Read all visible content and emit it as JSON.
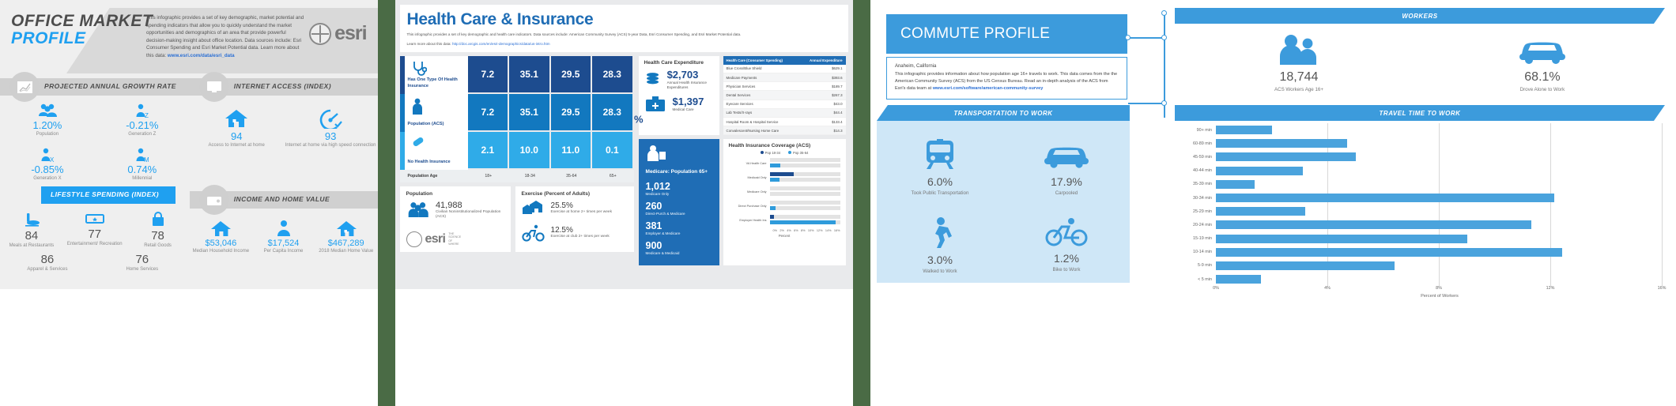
{
  "panel1": {
    "title_line1": "OFFICE MARKET",
    "title_line2": "PROFILE",
    "description": "This infographic provides a set of key demographic, market potential and spending indicators that allow you to quickly understand the market opportunities and demographics of an area that provide powerful decision-making insight about office location.\nData sources include: Esri Consumer Spending and Esri Market Potential data.\nLearn more about this data:",
    "description_link": "www.esri.com/data/esri_data",
    "brand": "esri",
    "sections": {
      "growth": {
        "band_label": "PROJECTED ANNUAL GROWTH RATE",
        "icon": "line-chart-icon",
        "stats": [
          {
            "value": "1.20%",
            "caption": "Population",
            "icon": "people-group-icon"
          },
          {
            "value": "-0.21%",
            "caption": "Generation Z",
            "icon": "person-z-icon"
          },
          {
            "value": "-0.85%",
            "caption": "Generation X",
            "icon": "person-x-icon"
          },
          {
            "value": "0.74%",
            "caption": "Millennial",
            "icon": "person-m-icon"
          }
        ]
      },
      "internet": {
        "band_label": "INTERNET ACCESS (INDEX)",
        "icon": "monitor-icon",
        "stats": [
          {
            "value": "94",
            "caption": "Access to Internet at home",
            "icon": "house-icon"
          },
          {
            "value": "93",
            "caption": "Internet at home via high speed connection",
            "icon": "speed-gauge-icon"
          }
        ]
      },
      "lifestyle": {
        "band_label": "LIFESTYLE SPENDING (INDEX)",
        "stats": [
          {
            "value": "84",
            "caption": "Meals at Restaurants",
            "icon": "food-drink-icon"
          },
          {
            "value": "77",
            "caption": "Entertainment/ Recreation",
            "icon": "ticket-icon"
          },
          {
            "value": "78",
            "caption": "Retail Goods",
            "icon": "shopping-bag-icon"
          },
          {
            "value": "86",
            "caption": "Apparel & Services",
            "icon": "apparel-icon"
          },
          {
            "value": "76",
            "caption": "Home Services",
            "icon": "home-services-icon"
          }
        ]
      },
      "income": {
        "band_label": "INCOME AND HOME VALUE",
        "icon": "wallet-icon",
        "stats": [
          {
            "value": "$53,046",
            "caption": "Median Household Income",
            "icon": "house-income-icon"
          },
          {
            "value": "$17,524",
            "caption": "Per Capita Income",
            "icon": "person-income-icon"
          },
          {
            "value": "$467,289",
            "caption": "2018 Median Home Value",
            "icon": "home-value-icon"
          }
        ]
      }
    }
  },
  "panel2": {
    "title": "Health Care & Insurance",
    "subtitle": "This infographic provides a set of key demographic and health care indicators. Data sources include: American Community Survey (ACS) 5-year Data, Esri Consumer Spending, and Esri Market Potential data.",
    "link_label": "Learn more about this data:",
    "link_url": "http://doc.arcgis.com/en/esri-demographics/data/us-intro.htm",
    "insurance_table": {
      "rows": [
        {
          "label": "Has One Type Of Health Insurance",
          "icon": "stethoscope-icon",
          "color": "#1d4c8f",
          "values": [
            "7.2",
            "35.1",
            "29.5",
            "28.3"
          ]
        },
        {
          "label": "Population (ACS)",
          "icon": "person-icon",
          "color": "#1278bf",
          "values": [
            "7.2",
            "35.1",
            "29.5",
            "28.3"
          ]
        },
        {
          "label": "No Health Insurance",
          "icon": "pill-icon",
          "color": "#2fabe8",
          "values": [
            "2.1",
            "10.0",
            "11.0",
            "0.1"
          ]
        }
      ],
      "footer_label": "Population Age",
      "age_groups": [
        "18+",
        "18-34",
        "35-64",
        "65+"
      ],
      "unit": "%"
    },
    "population_card": {
      "header": "Population",
      "value": "41,988",
      "caption": "Civilian Noninstitutionalized Population (ACS)",
      "icon": "people-group-icon"
    },
    "exercise_card": {
      "header": "Exercise (Percent of Adults)",
      "items": [
        {
          "value": "25.5%",
          "caption": "Exercise at home 2+ times per week",
          "icon": "home-exercise-icon"
        },
        {
          "value": "12.5%",
          "caption": "Exercise at club 2+ times per week",
          "icon": "bicycle-icon"
        }
      ]
    },
    "expenditure_card": {
      "header": "Health Care Expenditure",
      "items": [
        {
          "value": "$2,703",
          "caption": "Annual Health Insurance Expenditures",
          "icon": "coins-icon"
        },
        {
          "value": "$1,397",
          "caption": "Medical Care",
          "icon": "medical-bag-icon"
        }
      ]
    },
    "spending_table": {
      "col_category": "Health Care (Consumer Spending)",
      "col_value": "Annual Expenditure",
      "rows": [
        {
          "label": "Blue Cross/Blue Shield",
          "value": "$629.1"
        },
        {
          "label": "Medicare Payments",
          "value": "$393.6"
        },
        {
          "label": "Physician Services",
          "value": "$189.7"
        },
        {
          "label": "Dental Services",
          "value": "$267.3"
        },
        {
          "label": "Eyecare Services",
          "value": "$43.0"
        },
        {
          "label": "Lab Tests/X-rays",
          "value": "$44.4"
        },
        {
          "label": "Hospital Room & Hospital Service",
          "value": "$133.4"
        },
        {
          "label": "Convalescent/Nursing Home Care",
          "value": "$14.3"
        }
      ]
    },
    "medicare_box": {
      "header": "Medicare: Population 65+",
      "icon": "person-medicare-icon",
      "items": [
        {
          "value": "1,012",
          "caption": "Medicare Only"
        },
        {
          "value": "260",
          "caption": "Direct-Purch & Medicare"
        },
        {
          "value": "381",
          "caption": "Employer & Medicare"
        },
        {
          "value": "900",
          "caption": "Medicare & Medicaid"
        }
      ]
    },
    "coverage_chart": {
      "title": "Health Insurance Coverage (ACS)",
      "legend": [
        {
          "label": "Pop 18-34",
          "color": "#1d4c8f"
        },
        {
          "label": "Pop 35-64",
          "color": "#2f9bdb"
        }
      ],
      "xlabel": "Percent",
      "x_ticks": [
        "0%",
        "2%",
        "4%",
        "6%",
        "8%",
        "10%",
        "12%",
        "14%",
        "16%"
      ],
      "rows": [
        {
          "label": "VA Health Care",
          "pop1834": 0.0,
          "pop3564": 2.5
        },
        {
          "label": "Medicaid Only",
          "pop1834": 5.4,
          "pop3564": 2.3
        },
        {
          "label": "Medicare Only",
          "pop1834": 0.0,
          "pop3564": 0.0
        },
        {
          "label": "Direct Purchase Only",
          "pop1834": 0.0,
          "pop3564": 1.3
        },
        {
          "label": "Employer Health Ins",
          "pop1834": 0.9,
          "pop3564": 15.1
        }
      ],
      "xmax": 16
    }
  },
  "panel3": {
    "title": "COMMUTE PROFILE",
    "place": "Anaheim, California",
    "description": "This infographic provides information about how population age 16+ travels to work. This data comes from the the American Community Survey (ACS) from the US Census Bureau. Read an in-depth analysis of the ACS from Esri's data team at",
    "description_link": "www.esri.com/software/american-community-survey",
    "workers_band": "WORKERS",
    "workers": [
      {
        "value": "18,744",
        "caption": "ACS Workers Age 16+",
        "icon": "two-people-icon"
      },
      {
        "value": "68.1%",
        "caption": "Drove Alone to Work",
        "icon": "car-icon"
      }
    ],
    "transport_band": "TRANSPORTATION TO WORK",
    "transport": [
      {
        "value": "6.0%",
        "caption": "Took Public Transportation",
        "icon": "train-icon"
      },
      {
        "value": "17.9%",
        "caption": "Carpooled",
        "icon": "car-icon"
      },
      {
        "value": "3.0%",
        "caption": "Walked to Work",
        "icon": "walking-person-icon"
      },
      {
        "value": "1.2%",
        "caption": "Bike to Work",
        "icon": "bicycle-icon"
      }
    ],
    "travel_band": "TRAVEL TIME TO WORK",
    "chart_data": {
      "type": "bar",
      "orientation": "horizontal",
      "title": "TRAVEL TIME TO WORK",
      "xlabel": "Percent of Workers",
      "ylabel": "",
      "categories": [
        "90+ min",
        "60-89 min",
        "45-59 min",
        "40-44 min",
        "35-39 min",
        "30-34 min",
        "25-29 min",
        "20-24 min",
        "15-19 min",
        "10-14 min",
        "5-9 min",
        "< 5 min"
      ],
      "values": [
        2.0,
        4.7,
        5.0,
        3.1,
        1.4,
        12.1,
        3.2,
        11.3,
        9.0,
        12.4,
        6.4,
        1.6
      ],
      "xlim": [
        0,
        16
      ],
      "x_ticks": [
        "0%",
        "4%",
        "8%",
        "12%",
        "16%"
      ],
      "bar_color": "#4aa3dd",
      "grid": true,
      "legend": "none"
    }
  },
  "colors": {
    "esri_blue": "#1fa0f0",
    "dark_blue": "#1d4c8f",
    "mid_blue": "#1278bf",
    "light_blue": "#2fabe8",
    "commute_blue": "#3c9bdc",
    "panel_gray": "#efefef"
  }
}
